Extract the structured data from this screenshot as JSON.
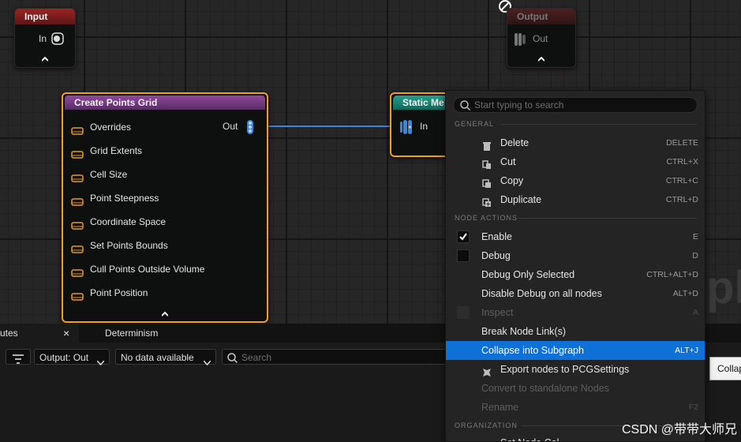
{
  "input_node": {
    "title": "Input",
    "pin": "In"
  },
  "output_node": {
    "title": "Output",
    "pin": "Out"
  },
  "create_node": {
    "title": "Create Points Grid",
    "out_label": "Out",
    "pins": [
      "Overrides",
      "Grid Extents",
      "Cell Size",
      "Point Steepness",
      "Coordinate Space",
      "Set Points Bounds",
      "Cull Points Outside Volume",
      "Point Position"
    ]
  },
  "static_node": {
    "title": "Static Me",
    "pin": "In"
  },
  "bg_text": "pl",
  "bottom": {
    "tabs": [
      {
        "label": "utes"
      },
      {
        "label": "Determinism"
      }
    ],
    "close_icon": "×",
    "output_select": "Output: Out",
    "data_select": "No data available",
    "search_placeholder": "Search",
    "tooltip": "Collap"
  },
  "menu": {
    "search_placeholder": "Start typing to search",
    "general_header": "GENERAL",
    "general": [
      {
        "label": "Delete",
        "shortcut": "DELETE",
        "icon": "trash-icon"
      },
      {
        "label": "Cut",
        "shortcut": "CTRL+X",
        "icon": "cut-icon"
      },
      {
        "label": "Copy",
        "shortcut": "CTRL+C",
        "icon": "copy-icon"
      },
      {
        "label": "Duplicate",
        "shortcut": "CTRL+D",
        "icon": "duplicate-icon"
      }
    ],
    "node_actions_header": "NODE ACTIONS",
    "node_actions": [
      {
        "label": "Enable",
        "shortcut": "E",
        "checked": true
      },
      {
        "label": "Debug",
        "shortcut": "D",
        "checked": false
      },
      {
        "label": "Debug Only Selected",
        "shortcut": "CTRL+ALT+D"
      },
      {
        "label": "Disable Debug on all nodes",
        "shortcut": "ALT+D"
      },
      {
        "label": "Inspect",
        "shortcut": "A",
        "disabled": true
      },
      {
        "label": "Break Node Link(s)",
        "shortcut": ""
      },
      {
        "label": "Collapse into Subgraph",
        "shortcut": "ALT+J",
        "selected": true
      },
      {
        "label": "Export nodes to PCGSettings",
        "shortcut": "",
        "icon": "export-icon"
      },
      {
        "label": "Convert to standalone Nodes",
        "shortcut": "",
        "disabled": true
      },
      {
        "label": "Rename",
        "shortcut": "F2",
        "disabled": true
      }
    ],
    "organization_header": "ORGANIZATION",
    "partial_item": "Set Node Col"
  },
  "watermark": "CSDN @带带大师兄",
  "colors": {
    "accent": "#0f70d7",
    "selection_border": "#f0a01a",
    "create_header": "#7a3b88",
    "static_header": "#1f8a7a",
    "input_header": "#8c1f1f",
    "wire": "#3a86d8"
  }
}
